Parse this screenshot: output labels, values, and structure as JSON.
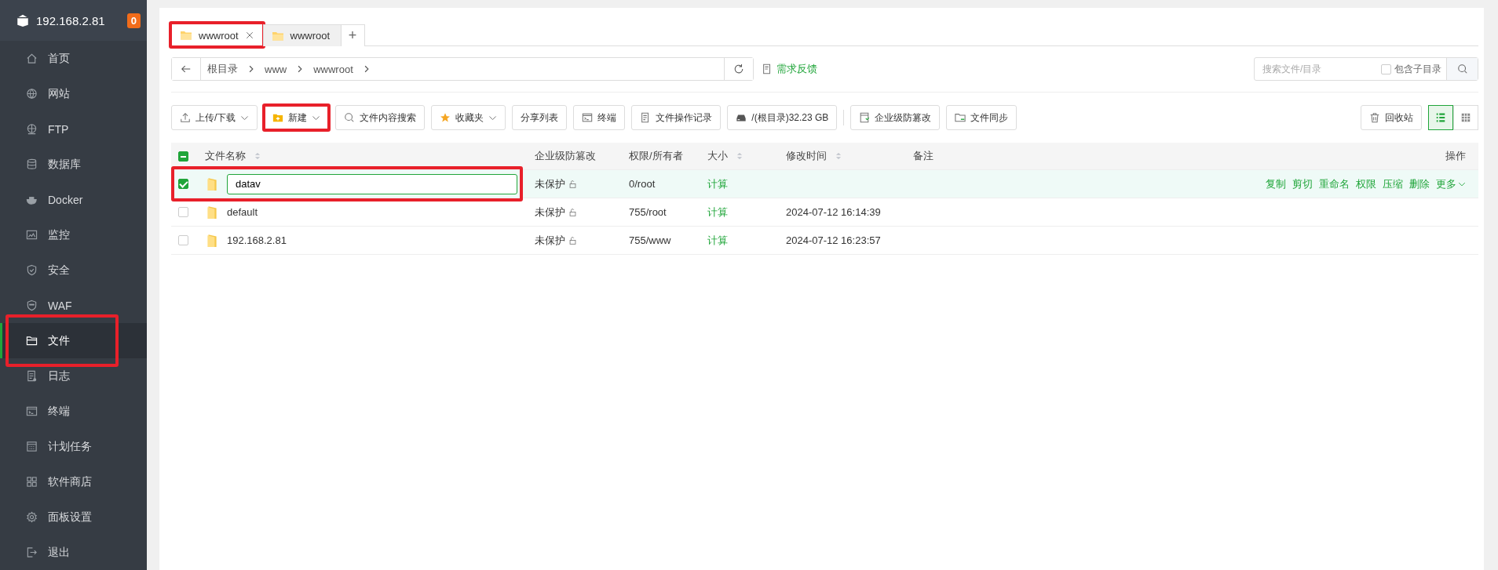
{
  "sidebar": {
    "host": "192.168.2.81",
    "badge": "0",
    "items": [
      {
        "label": "首页",
        "selected": false,
        "highlighted": false
      },
      {
        "label": "网站",
        "selected": false,
        "highlighted": false
      },
      {
        "label": "FTP",
        "selected": false,
        "highlighted": false
      },
      {
        "label": "数据库",
        "selected": false,
        "highlighted": false
      },
      {
        "label": "Docker",
        "selected": false,
        "highlighted": false
      },
      {
        "label": "监控",
        "selected": false,
        "highlighted": false
      },
      {
        "label": "安全",
        "selected": false,
        "highlighted": false
      },
      {
        "label": "WAF",
        "selected": false,
        "highlighted": false
      },
      {
        "label": "文件",
        "selected": true,
        "highlighted": true
      },
      {
        "label": "日志",
        "selected": false,
        "highlighted": false
      },
      {
        "label": "终端",
        "selected": false,
        "highlighted": false
      },
      {
        "label": "计划任务",
        "selected": false,
        "highlighted": false
      },
      {
        "label": "软件商店",
        "selected": false,
        "highlighted": false
      },
      {
        "label": "面板设置",
        "selected": false,
        "highlighted": false
      },
      {
        "label": "退出",
        "selected": false,
        "highlighted": false
      }
    ]
  },
  "tabs": [
    {
      "label": "wwwroot",
      "selected": true,
      "closable": true,
      "highlighted": true
    },
    {
      "label": "wwwroot",
      "selected": false,
      "closable": false,
      "highlighted": false
    }
  ],
  "new_tab": "+",
  "path": {
    "segments": [
      "根目录",
      "www",
      "wwwroot"
    ]
  },
  "feedback": "需求反馈",
  "search": {
    "placeholder": "搜索文件/目录",
    "subdir_label": "包含子目录",
    "subdir_checked": false
  },
  "toolbar": [
    {
      "label": "上传/下载",
      "dropdown": true,
      "highlighted": false
    },
    {
      "label": "新建",
      "dropdown": true,
      "highlighted": true
    },
    {
      "label": "文件内容搜索",
      "dropdown": false,
      "highlighted": false
    },
    {
      "label": "收藏夹",
      "dropdown": true,
      "highlighted": false
    },
    {
      "label": "分享列表",
      "dropdown": false,
      "highlighted": false
    },
    {
      "label": "终端",
      "dropdown": false,
      "highlighted": false
    },
    {
      "label": "文件操作记录",
      "dropdown": false,
      "highlighted": false
    },
    {
      "label": "/(根目录)32.23 GB",
      "dropdown": false,
      "highlighted": false
    },
    {
      "label": "企业级防篡改",
      "dropdown": false,
      "highlighted": false
    },
    {
      "label": "文件同步",
      "dropdown": false,
      "highlighted": false
    }
  ],
  "recycle": "回收站",
  "view_modes": [
    {
      "selected": true
    },
    {
      "selected": false
    }
  ],
  "table": {
    "some_checked": true,
    "columns": [
      {
        "label": "文件名称",
        "sortable": true
      },
      {
        "label": "企业级防篡改",
        "sortable": false
      },
      {
        "label": "权限/所有者",
        "sortable": false
      },
      {
        "label": "大小",
        "sortable": true
      },
      {
        "label": "修改时间",
        "sortable": true
      },
      {
        "label": "备注",
        "sortable": false
      },
      {
        "label": "操作",
        "sortable": false
      }
    ],
    "rows": [
      {
        "checked": true,
        "editing": true,
        "highlighted": true,
        "name": "datav",
        "protection": "未保护",
        "perm": "0/root",
        "size": "计算",
        "actions": [
          "复制",
          "剪切",
          "重命名",
          "权限",
          "压缩",
          "删除"
        ],
        "more": "更多"
      },
      {
        "checked": false,
        "editing": false,
        "highlighted": false,
        "name": "default",
        "protection": "未保护",
        "perm": "755/root",
        "size": "计算",
        "mtime": "2024-07-12 16:14:39"
      },
      {
        "checked": false,
        "editing": false,
        "highlighted": false,
        "name": "192.168.2.81",
        "protection": "未保护",
        "perm": "755/www",
        "size": "计算",
        "mtime": "2024-07-12 16:23:57"
      }
    ]
  }
}
